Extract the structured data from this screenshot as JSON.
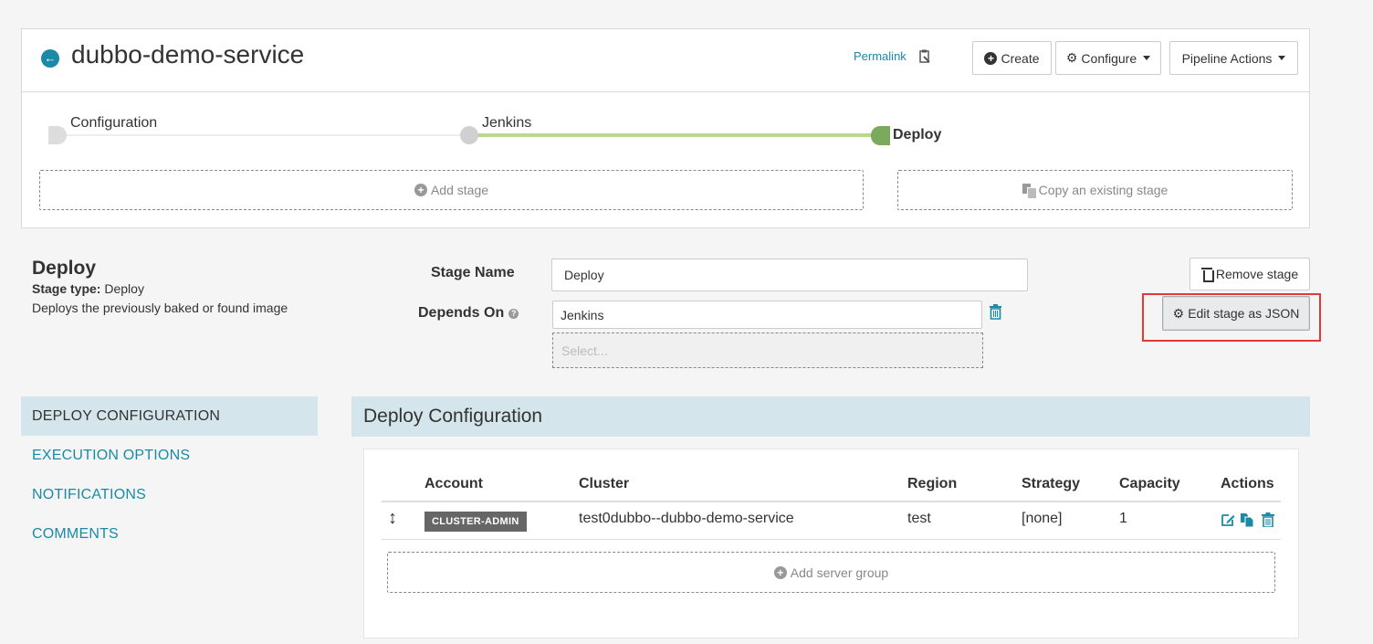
{
  "header": {
    "title": "dubbo-demo-service",
    "permalink": "Permalink",
    "create_label": "Create",
    "configure_label": "Configure",
    "pipeline_actions_label": "Pipeline Actions"
  },
  "graph": {
    "stages": [
      {
        "label": "Configuration"
      },
      {
        "label": "Jenkins"
      },
      {
        "label": "Deploy"
      }
    ],
    "add_stage_label": "Add stage",
    "copy_stage_label": "Copy an existing stage"
  },
  "stage": {
    "heading": "Deploy",
    "type_label": "Stage type:",
    "type_value": "Deploy",
    "description": "Deploys the previously baked or found image",
    "name_label": "Stage Name",
    "name_value": "Deploy",
    "depends_on_label": "Depends On",
    "depends_on_value": "Jenkins",
    "select_placeholder": "Select...",
    "remove_label": "Remove stage",
    "edit_json_label": "Edit stage as JSON"
  },
  "nav": {
    "items": [
      {
        "label": "DEPLOY CONFIGURATION"
      },
      {
        "label": "EXECUTION OPTIONS"
      },
      {
        "label": "NOTIFICATIONS"
      },
      {
        "label": "COMMENTS"
      }
    ]
  },
  "deploy_config": {
    "title": "Deploy Configuration",
    "columns": [
      "Account",
      "Cluster",
      "Region",
      "Strategy",
      "Capacity",
      "Actions"
    ],
    "rows": [
      {
        "account": "CLUSTER-ADMIN",
        "cluster": "test0dubbo--dubbo-demo-service",
        "region": "test",
        "strategy": "[none]",
        "capacity": "1"
      }
    ],
    "add_server_group_label": "Add server group"
  },
  "colors": {
    "accent": "#1a8aa8",
    "active_stage": "#7aab5c",
    "highlight": "#e03a3a",
    "section_bg": "#d4e6ec"
  }
}
